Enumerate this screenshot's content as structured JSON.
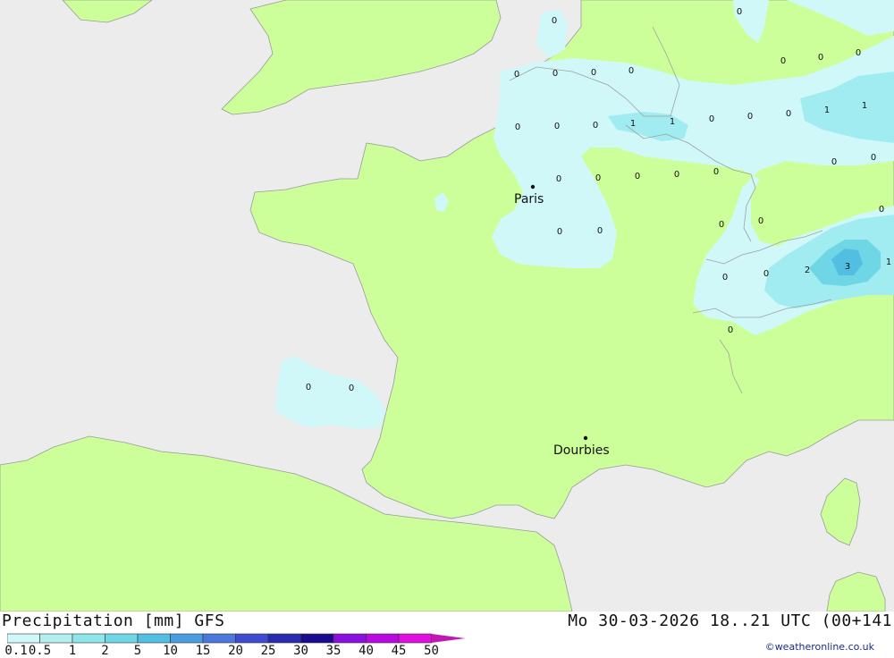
{
  "header": {
    "title_left": "Precipitation [mm] GFS",
    "title_right": "Mo 30-03-2026 18..21 UTC (00+141",
    "credit": "©weatheronline.co.uk"
  },
  "legend": {
    "labels": [
      "0.1",
      "0.5",
      "1",
      "2",
      "5",
      "10",
      "15",
      "20",
      "25",
      "30",
      "35",
      "40",
      "45",
      "50"
    ],
    "colors": [
      "#d0f8f8",
      "#b2f0f0",
      "#8de6ea",
      "#6fd6e6",
      "#52bfe2",
      "#4a9ee0",
      "#4a78dc",
      "#3f4ccf",
      "#2a2ab0",
      "#1a0a90",
      "#8a10e0",
      "#b80ae0",
      "#e010e0",
      "#c018b0"
    ]
  },
  "map": {
    "colors": {
      "sea": "#ececec",
      "land": "#ccff99",
      "light_precip": "#d0f8f8",
      "mid_precip": "#a0ecf0",
      "heavy_precip": "#52bfe2",
      "border": "#a0a0a0"
    },
    "cities": [
      {
        "name": "Paris"
      },
      {
        "name": "Dourbies"
      }
    ],
    "values": [
      "0",
      "0",
      "0",
      "0",
      "0",
      "0",
      "0",
      "0",
      "0",
      "0",
      "1",
      "1",
      "0",
      "0",
      "0",
      "1",
      "1",
      "0",
      "0",
      "0",
      "0",
      "0",
      "0",
      "0",
      "0",
      "0",
      "0",
      "0",
      "0",
      "0",
      "0",
      "0",
      "0",
      "0",
      "2",
      "3",
      "1",
      "0",
      "0",
      "0"
    ]
  }
}
